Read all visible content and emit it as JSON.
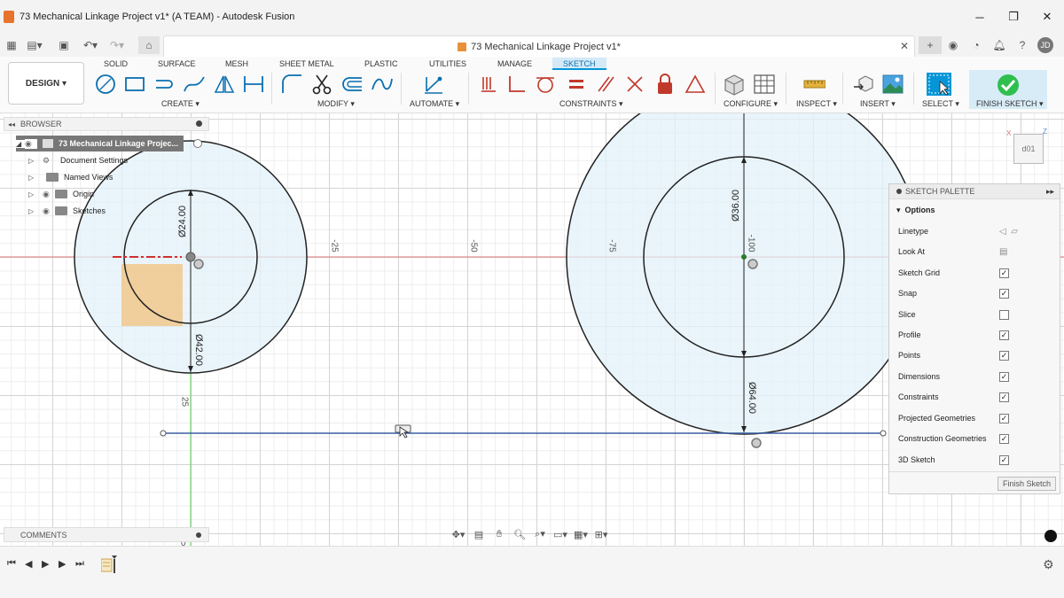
{
  "window": {
    "title": "73 Mechanical Linkage Project v1* (A TEAM) - Autodesk Fusion",
    "controls": [
      "minimize",
      "maximize",
      "close"
    ]
  },
  "document_tab": {
    "title": "73 Mechanical Linkage Project v1*"
  },
  "ribbon": {
    "workspace": "DESIGN",
    "tabs": [
      {
        "label": "SOLID",
        "active": false
      },
      {
        "label": "SURFACE",
        "active": false
      },
      {
        "label": "MESH",
        "active": false
      },
      {
        "label": "SHEET METAL",
        "active": false
      },
      {
        "label": "PLASTIC",
        "active": false
      },
      {
        "label": "UTILITIES",
        "active": false
      },
      {
        "label": "MANAGE",
        "active": false
      },
      {
        "label": "SKETCH",
        "active": true
      }
    ],
    "groups": {
      "create": "CREATE",
      "modify": "MODIFY",
      "automate": "AUTOMATE",
      "constraints": "CONSTRAINTS",
      "configure": "CONFIGURE",
      "inspect": "INSPECT",
      "insert": "INSERT",
      "select": "SELECT",
      "finish": "FINISH SKETCH"
    }
  },
  "browser": {
    "header": "BROWSER",
    "root": "73 Mechanical Linkage Projec...",
    "items": [
      {
        "label": "Document Settings"
      },
      {
        "label": "Named Views"
      },
      {
        "label": "Origin"
      },
      {
        "label": "Sketches"
      }
    ]
  },
  "sketch": {
    "dimensions": {
      "d1": "Ø24.00",
      "d2": "Ø42.00",
      "d3": "Ø36.00",
      "d4": "Ø64.00"
    },
    "axis_labels": {
      "x1": "-25",
      "x2": "-50",
      "x3": "-75",
      "x4": "-100",
      "y1": "25"
    }
  },
  "sketch_palette": {
    "header": "SKETCH PALETTE",
    "section": "Options",
    "rows": [
      {
        "label": "Linetype",
        "type": "icon"
      },
      {
        "label": "Look At",
        "type": "icon"
      },
      {
        "label": "Sketch Grid",
        "checked": true
      },
      {
        "label": "Snap",
        "checked": true
      },
      {
        "label": "Slice",
        "checked": false
      },
      {
        "label": "Profile",
        "checked": true
      },
      {
        "label": "Points",
        "checked": true
      },
      {
        "label": "Dimensions",
        "checked": true
      },
      {
        "label": "Constraints",
        "checked": true
      },
      {
        "label": "Projected Geometries",
        "checked": true
      },
      {
        "label": "Construction Geometries",
        "checked": true
      },
      {
        "label": "3D Sketch",
        "checked": true
      }
    ],
    "finish_button": "Finish Sketch"
  },
  "viewcube": {
    "face": "d01"
  },
  "comments": {
    "header": "COMMENTS"
  },
  "colors": {
    "accent": "#0696d7",
    "sketch_line": "#222222",
    "profile_fill": "#e3f1fa",
    "selection_box": "#f1c27d",
    "finish_check": "#2fbf4f"
  }
}
